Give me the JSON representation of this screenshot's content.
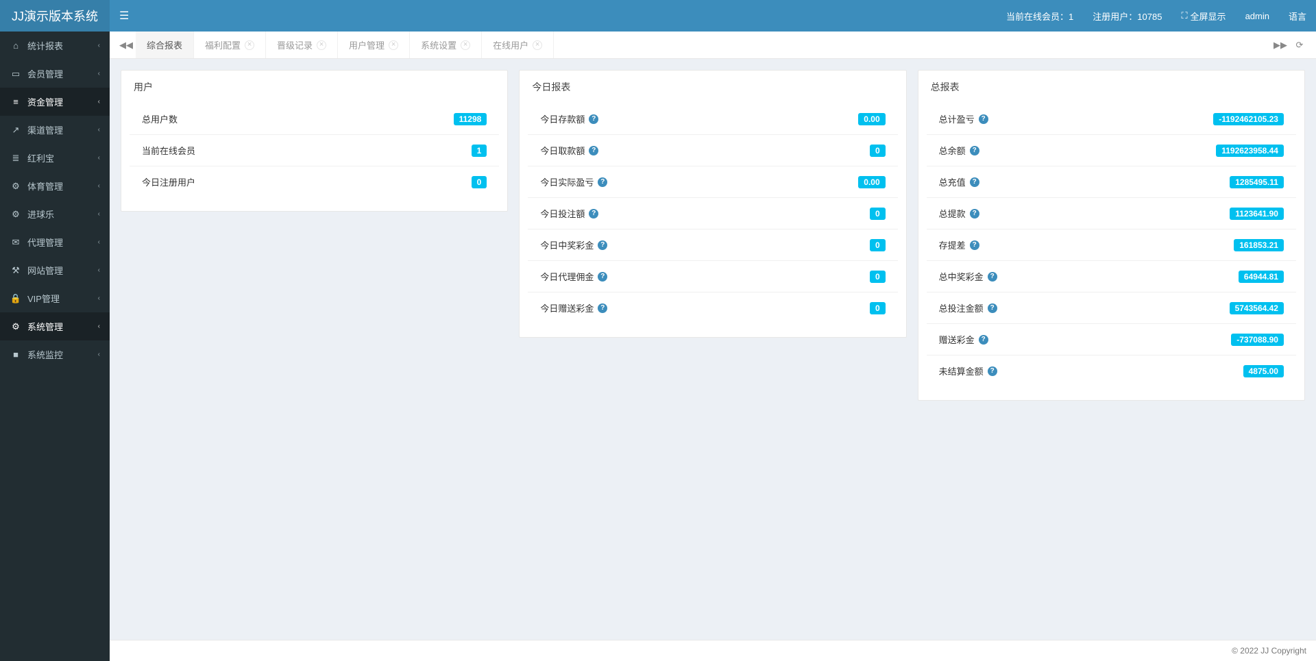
{
  "app_title": "JJ演示版本系统",
  "topbar": {
    "online_label": "当前在线会员：1",
    "reg_label": "注册用户：10785",
    "fullscreen": "全屏显示",
    "user": "admin",
    "lang": "语言"
  },
  "sidebar": {
    "items": [
      {
        "icon": "home-icon",
        "glyph": "⌂",
        "label": "统计报表"
      },
      {
        "icon": "users-icon",
        "glyph": "▭",
        "label": "会员管理"
      },
      {
        "icon": "money-icon",
        "glyph": "≡",
        "label": "资金管理",
        "active": true
      },
      {
        "icon": "channel-icon",
        "glyph": "↗",
        "label": "渠道管理"
      },
      {
        "icon": "bonus-icon",
        "glyph": "≣",
        "label": "红利宝"
      },
      {
        "icon": "sport-icon",
        "glyph": "⚙",
        "label": "体育管理"
      },
      {
        "icon": "ball-icon",
        "glyph": "⚙",
        "label": "进球乐"
      },
      {
        "icon": "agent-icon",
        "glyph": "✉",
        "label": "代理管理"
      },
      {
        "icon": "site-icon",
        "glyph": "⚒",
        "label": "网站管理"
      },
      {
        "icon": "vip-icon",
        "glyph": "🔒",
        "label": "VIP管理"
      },
      {
        "icon": "system-icon",
        "glyph": "⚙",
        "label": "系统管理",
        "active": true
      },
      {
        "icon": "monitor-icon",
        "glyph": "■",
        "label": "系统监控"
      }
    ]
  },
  "tabs": [
    {
      "label": "综合报表",
      "closable": false,
      "active": true
    },
    {
      "label": "福利配置",
      "closable": true
    },
    {
      "label": "晋级记录",
      "closable": true
    },
    {
      "label": "用户管理",
      "closable": true
    },
    {
      "label": "系统设置",
      "closable": true
    },
    {
      "label": "在线用户",
      "closable": true
    }
  ],
  "panels": {
    "user": {
      "title": "用户",
      "rows": [
        {
          "label": "总用户数",
          "help": false,
          "value": "11298"
        },
        {
          "label": "当前在线会员",
          "help": false,
          "value": "1"
        },
        {
          "label": "今日注册用户",
          "help": false,
          "value": "0"
        }
      ]
    },
    "today": {
      "title": "今日报表",
      "rows": [
        {
          "label": "今日存款額",
          "help": true,
          "value": "0.00"
        },
        {
          "label": "今日取款額",
          "help": true,
          "value": "0"
        },
        {
          "label": "今日实际盈亏",
          "help": true,
          "value": "0.00"
        },
        {
          "label": "今日投注額",
          "help": true,
          "value": "0"
        },
        {
          "label": "今日中奖彩金",
          "help": true,
          "value": "0"
        },
        {
          "label": "今日代理佣金",
          "help": true,
          "value": "0"
        },
        {
          "label": "今日赠送彩金",
          "help": true,
          "value": "0"
        }
      ]
    },
    "total": {
      "title": "总报表",
      "rows": [
        {
          "label": "总计盈亏",
          "help": true,
          "value": "-1192462105.23"
        },
        {
          "label": "总余额",
          "help": true,
          "value": "1192623958.44"
        },
        {
          "label": "总充值",
          "help": true,
          "value": "1285495.11"
        },
        {
          "label": "总提款",
          "help": true,
          "value": "1123641.90"
        },
        {
          "label": "存提差",
          "help": true,
          "value": "161853.21"
        },
        {
          "label": "总中奖彩金",
          "help": true,
          "value": "64944.81"
        },
        {
          "label": "总投注金额",
          "help": true,
          "value": "5743564.42"
        },
        {
          "label": "赠送彩金",
          "help": true,
          "value": "-737088.90"
        },
        {
          "label": "未结算金额",
          "help": true,
          "value": "4875.00"
        }
      ]
    }
  },
  "footer": "© 2022 JJ Copyright"
}
